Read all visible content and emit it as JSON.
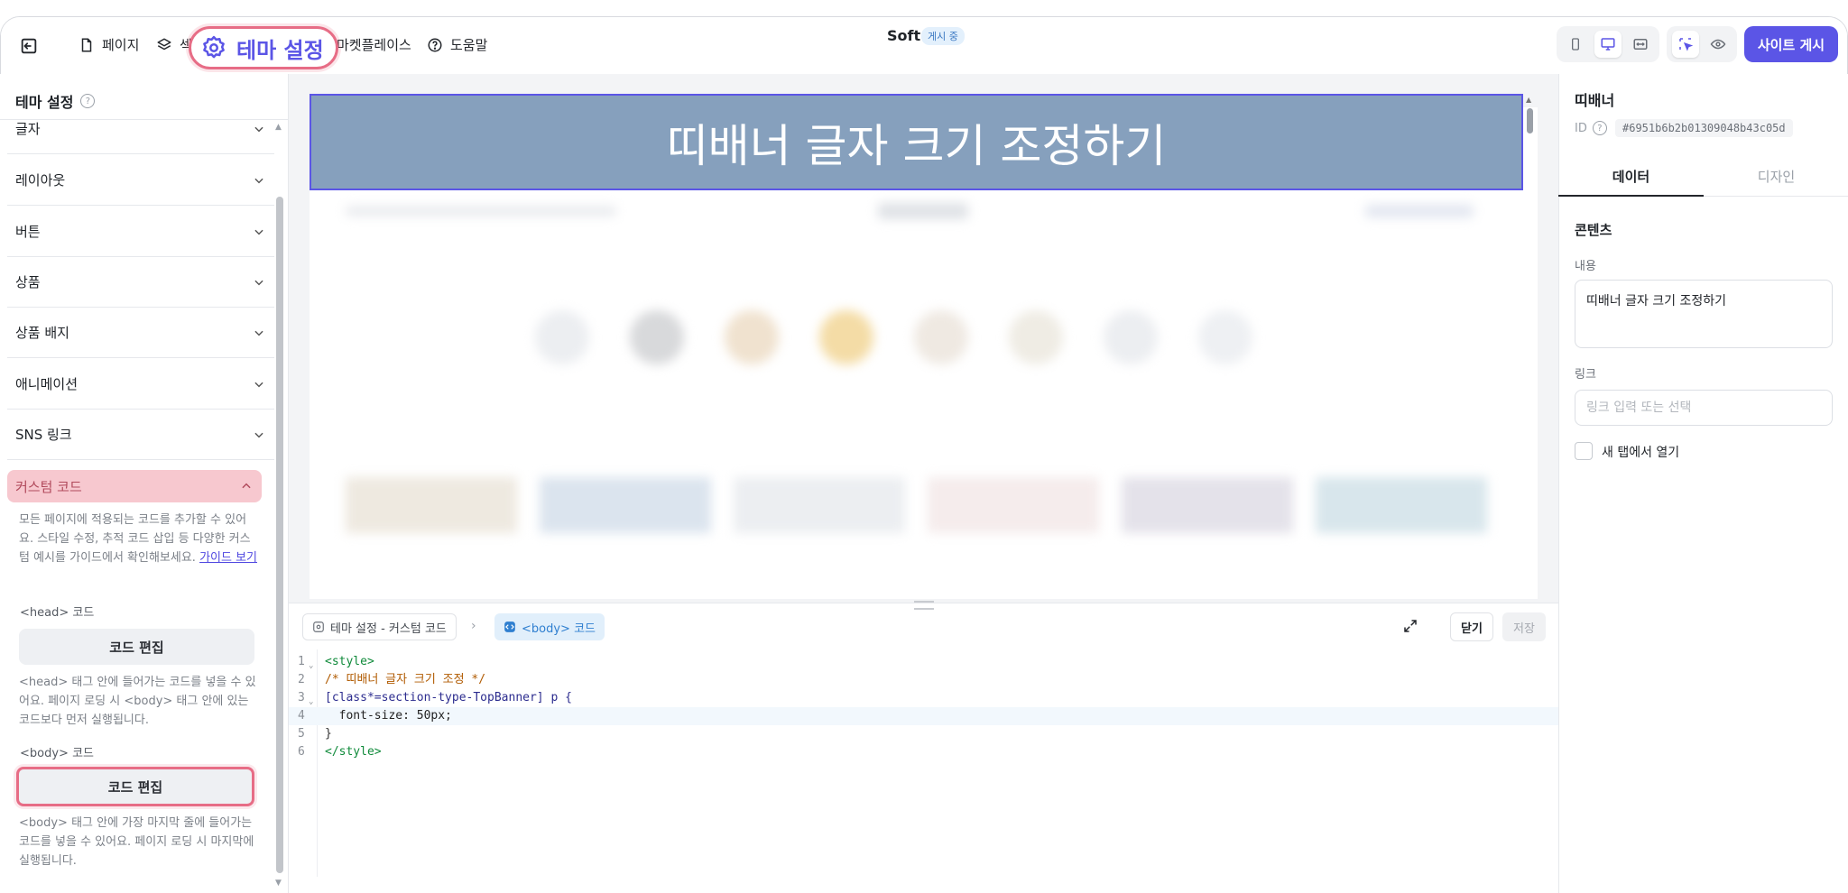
{
  "header": {
    "nav": [
      {
        "label": "페이지"
      },
      {
        "label": "섹"
      },
      {
        "label": "마켓플레이스"
      },
      {
        "label": "도움말"
      }
    ],
    "theme_settings_label": "테마 설정",
    "site_title": "Soft",
    "publish_badge": "게시 중",
    "publish_button": "사이트 게시",
    "accent_color": "#5b55e6"
  },
  "left_panel": {
    "title": "테마 설정",
    "accordions": [
      "글자",
      "레이아웃",
      "버튼",
      "상품",
      "상품 배지",
      "애니메이션",
      "SNS 링크"
    ],
    "custom_code": {
      "label": "커스텀 코드",
      "description": "모든 페이지에 적용되는 코드를 추가할 수 있어요. 스타일 수정, 추적 코드 삽입 등 다양한 커스텀 예시를 가이드에서 확인해보세요.",
      "guide_link": "가이드 보기",
      "head_label": "<head> 코드",
      "head_button": "코드 편집",
      "head_desc": "<head> 태그 안에 들어가는 코드를 넣을 수 있어요. 페이지 로딩 시 <body> 태그 안에 있는 코드보다 먼저 실행됩니다.",
      "body_label": "<body> 코드",
      "body_button": "코드 편집",
      "body_desc": "<body> 태그 안에 가장 마지막 줄에 들어가는 코드를 넣을 수 있어요. 페이지 로딩 시 마지막에 실행됩니다."
    }
  },
  "canvas": {
    "banner_text": "띠배너 글자 크기 조정하기",
    "banner_color": "#86a0bd"
  },
  "editor": {
    "breadcrumb_1": "테마 설정 - 커스텀 코드",
    "breadcrumb_2": "<body> 코드",
    "close_label": "닫기",
    "save_label": "저장",
    "lines": [
      {
        "n": "1",
        "text": "<style>"
      },
      {
        "n": "2",
        "text": "/* 띠배너 글자 크기 조정 */"
      },
      {
        "n": "3",
        "text": "[class*=section-type-TopBanner] p {"
      },
      {
        "n": "4",
        "text": "  font-size: 50px;"
      },
      {
        "n": "5",
        "text": "}"
      },
      {
        "n": "6",
        "text": "</style>"
      }
    ]
  },
  "right_panel": {
    "title": "띠배너",
    "id_label": "ID",
    "id_value": "#6951b6b2b01309048b43c05d",
    "tab_data": "데이터",
    "tab_design": "디자인",
    "section_title": "콘텐츠",
    "content_label": "내용",
    "content_value": "띠배너 글자 크기 조정하기",
    "link_label": "링크",
    "link_placeholder": "링크 입력 또는 선택",
    "new_tab_label": "새 탭에서 열기"
  }
}
